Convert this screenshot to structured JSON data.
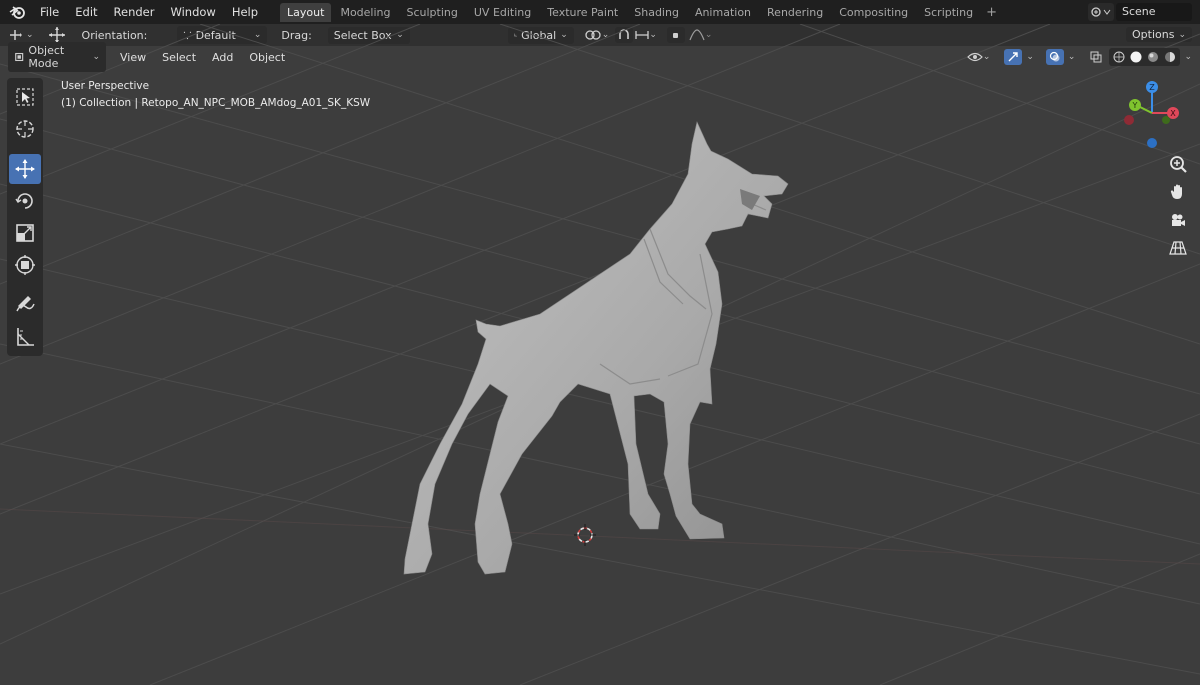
{
  "app_menu": [
    "File",
    "Edit",
    "Render",
    "Window",
    "Help"
  ],
  "workspace_tabs": [
    {
      "label": "Layout",
      "active": true
    },
    {
      "label": "Modeling"
    },
    {
      "label": "Sculpting"
    },
    {
      "label": "UV Editing"
    },
    {
      "label": "Texture Paint"
    },
    {
      "label": "Shading"
    },
    {
      "label": "Animation"
    },
    {
      "label": "Rendering"
    },
    {
      "label": "Compositing"
    },
    {
      "label": "Scripting"
    }
  ],
  "scene": {
    "name": "Scene"
  },
  "header": {
    "orientation_label": "Orientation:",
    "orientation_value": "Default",
    "drag_label": "Drag:",
    "drag_value": "Select Box",
    "transform_value": "Global",
    "options_label": "Options"
  },
  "view_header": {
    "mode": "Object Mode",
    "menus": [
      "View",
      "Select",
      "Add",
      "Object"
    ]
  },
  "viewport": {
    "perspective": "User Perspective",
    "collection": "(1) Collection | Retopo_AN_NPC_MOB_AMdog_A01_SK_KSW"
  },
  "toolbar": {
    "tools": [
      "select-box",
      "cursor",
      "move",
      "rotate",
      "scale",
      "transform",
      "annotate",
      "measure"
    ],
    "active": "move"
  },
  "colors": {
    "accent": "#4772b3",
    "axis_x": "#e0485a",
    "axis_y": "#7fc32e",
    "axis_z": "#3b8ee8",
    "background": "#3d3d3d"
  }
}
